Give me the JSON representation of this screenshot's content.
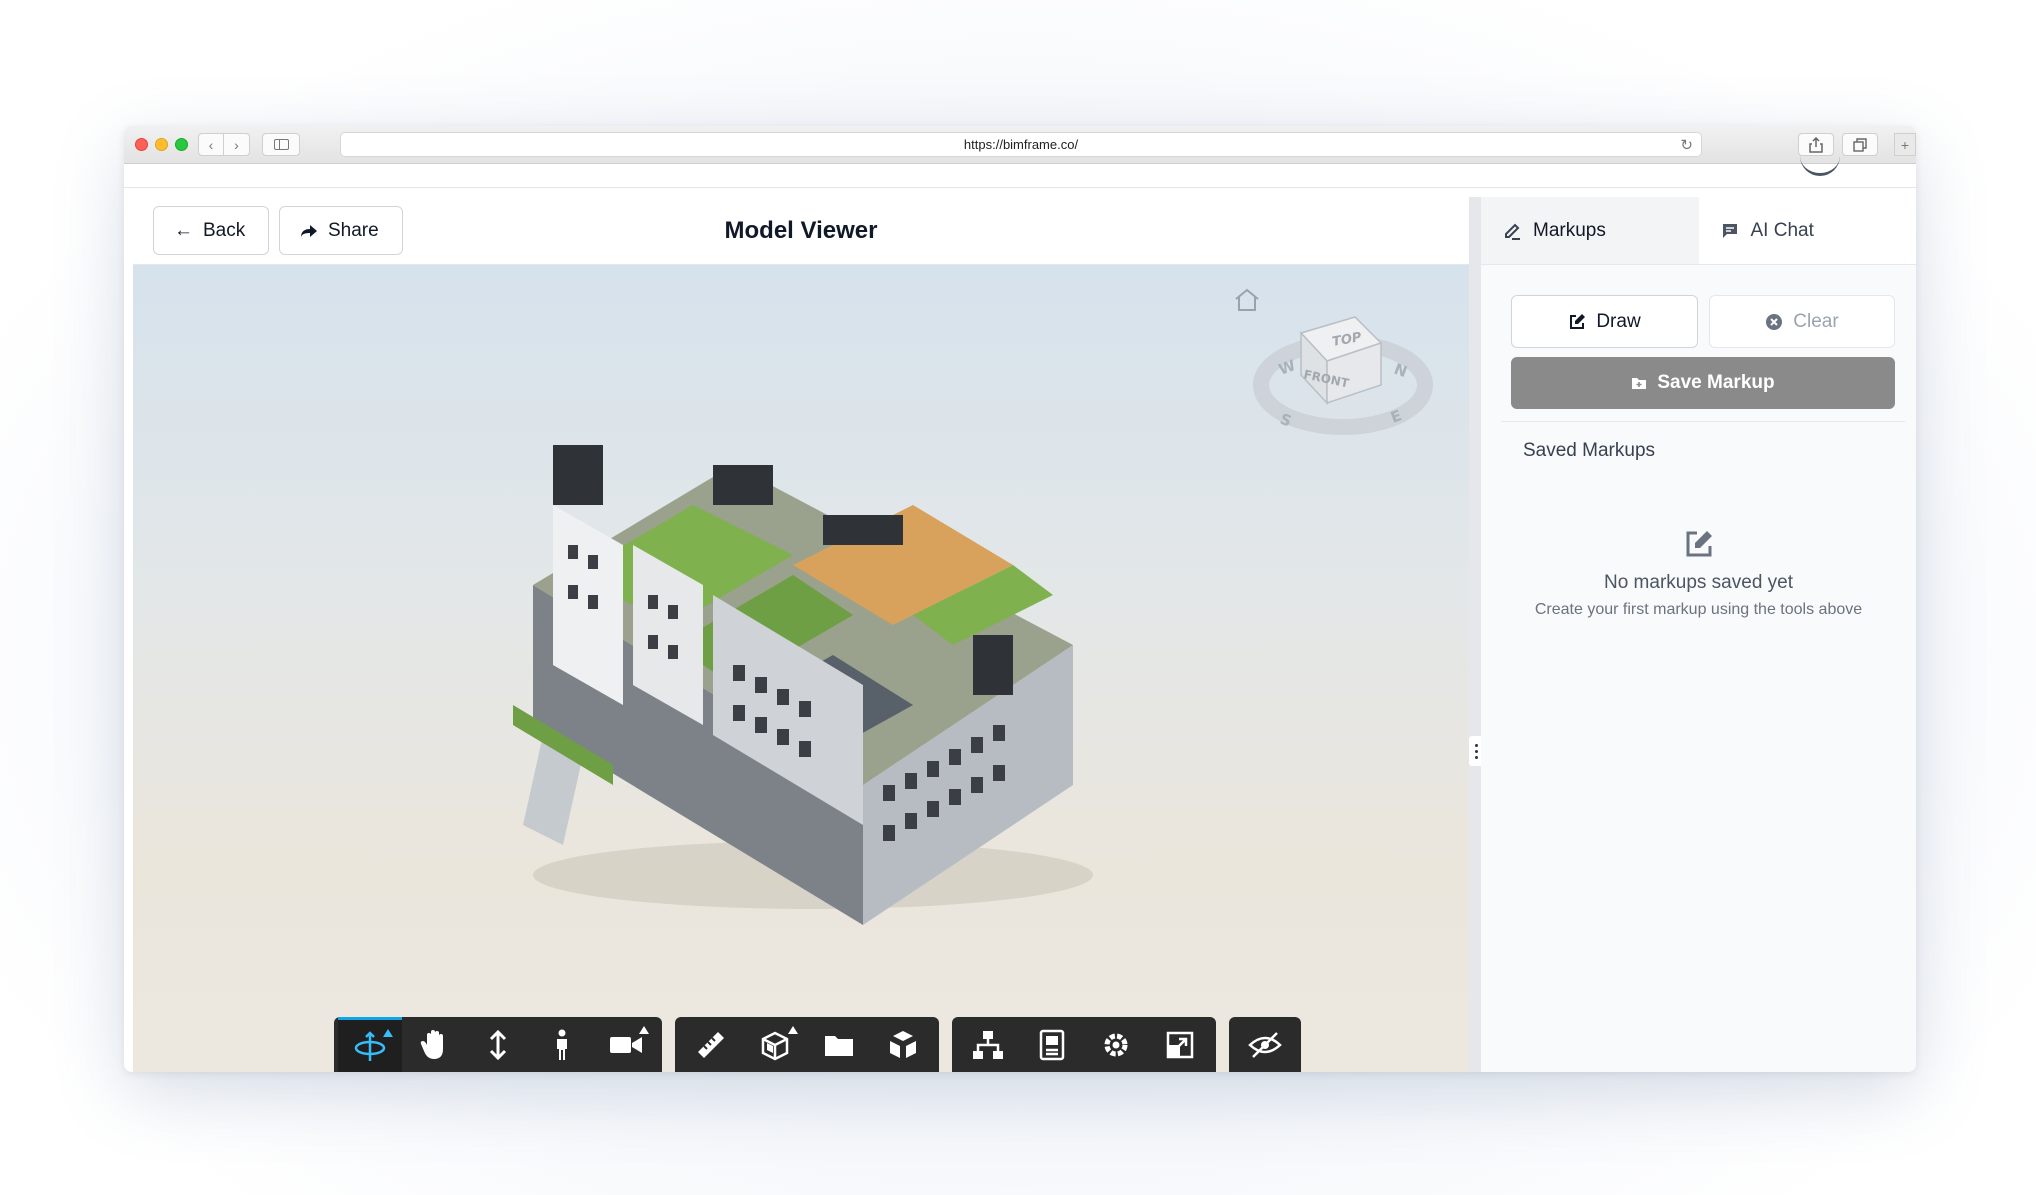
{
  "browser": {
    "url": "https://bimframe.co/"
  },
  "viewer": {
    "title": "Model Viewer",
    "back_label": "Back",
    "share_label": "Share",
    "viewcube": {
      "top_label": "TOP",
      "front_label": "FRONT",
      "compass": {
        "w": "W",
        "n": "N",
        "s": "S",
        "e": "E"
      }
    },
    "toolbar": {
      "groups": [
        [
          "orbit-icon",
          "pan-icon",
          "zoom-icon",
          "walk-icon",
          "camera-icon"
        ],
        [
          "measure-icon",
          "section-icon",
          "folder-icon",
          "explode-icon"
        ],
        [
          "model-tree-icon",
          "properties-icon",
          "settings-icon",
          "fullscreen-icon"
        ],
        [
          "visibility-off-icon"
        ]
      ],
      "active_tool": "orbit-icon"
    }
  },
  "panel": {
    "tabs": [
      {
        "label": "Markups",
        "icon": "markup-icon",
        "active": true
      },
      {
        "label": "AI Chat",
        "icon": "chat-icon",
        "active": false
      }
    ],
    "draw_label": "Draw",
    "clear_label": "Clear",
    "save_label": "Save Markup",
    "saved_title": "Saved Markups",
    "empty_title": "No markups saved yet",
    "empty_subtitle": "Create your first markup using the tools above"
  },
  "colors": {
    "accent": "#0ea5e9",
    "toolbar_bg": "#2b2b2b",
    "save_button_bg": "#8a8a8a"
  }
}
